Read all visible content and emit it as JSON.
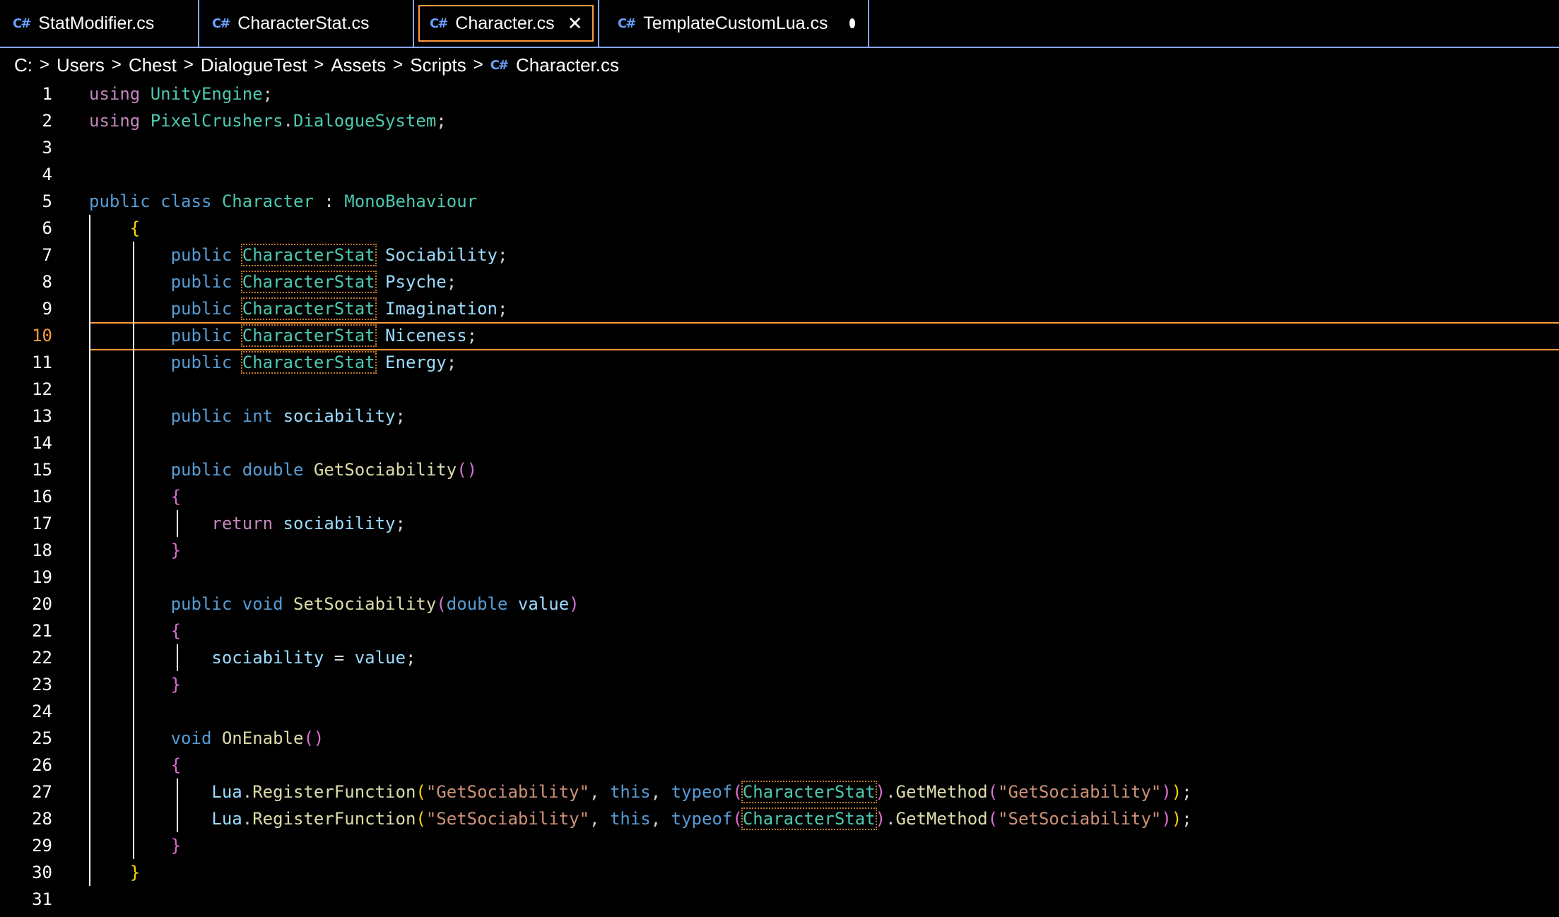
{
  "tabs": [
    {
      "label": "StatModifier.cs",
      "active": false,
      "dirty": false
    },
    {
      "label": "CharacterStat.cs",
      "active": false,
      "dirty": false
    },
    {
      "label": "Character.cs",
      "active": true,
      "dirty": false
    },
    {
      "label": "TemplateCustomLua.cs",
      "active": false,
      "dirty": true
    }
  ],
  "tab_icon": "C#",
  "breadcrumb": [
    "C:",
    "Users",
    "Chest",
    "DialogueTest",
    "Assets",
    "Scripts",
    "Character.cs"
  ],
  "current_line": 10,
  "line_numbers": [
    "1",
    "2",
    "3",
    "4",
    "5",
    "6",
    "7",
    "8",
    "9",
    "10",
    "11",
    "12",
    "13",
    "14",
    "15",
    "16",
    "17",
    "18",
    "19",
    "20",
    "21",
    "22",
    "23",
    "24",
    "25",
    "26",
    "27",
    "28",
    "29",
    "30",
    "31"
  ],
  "code_lines": [
    "using UnityEngine;",
    "using PixelCrushers.DialogueSystem;",
    "",
    "",
    "public class Character : MonoBehaviour",
    "    {",
    "        public CharacterStat Sociability;",
    "        public CharacterStat Psyche;",
    "        public CharacterStat Imagination;",
    "        public CharacterStat Niceness;",
    "        public CharacterStat Energy;",
    "",
    "        public int sociability;",
    "",
    "        public double GetSociability()",
    "        {",
    "            return sociability;",
    "        }",
    "",
    "        public void SetSociability(double value)",
    "        {",
    "            sociability = value;",
    "        }",
    "",
    "        void OnEnable()",
    "        {",
    "            Lua.RegisterFunction(\"GetSociability\", this, typeof(CharacterStat).GetMethod(\"GetSociability\"));",
    "            Lua.RegisterFunction(\"SetSociability\", this, typeof(CharacterStat).GetMethod(\"SetSociability\"));",
    "        }",
    "    }",
    ""
  ],
  "colors": {
    "keyword": "#569cd6",
    "control": "#c586c0",
    "type": "#4ec9b0",
    "function": "#dcdcaa",
    "variable": "#9cdcfe",
    "string": "#ce9178",
    "accent": "#ff9a3c",
    "tab_border": "#8aa6ff"
  }
}
